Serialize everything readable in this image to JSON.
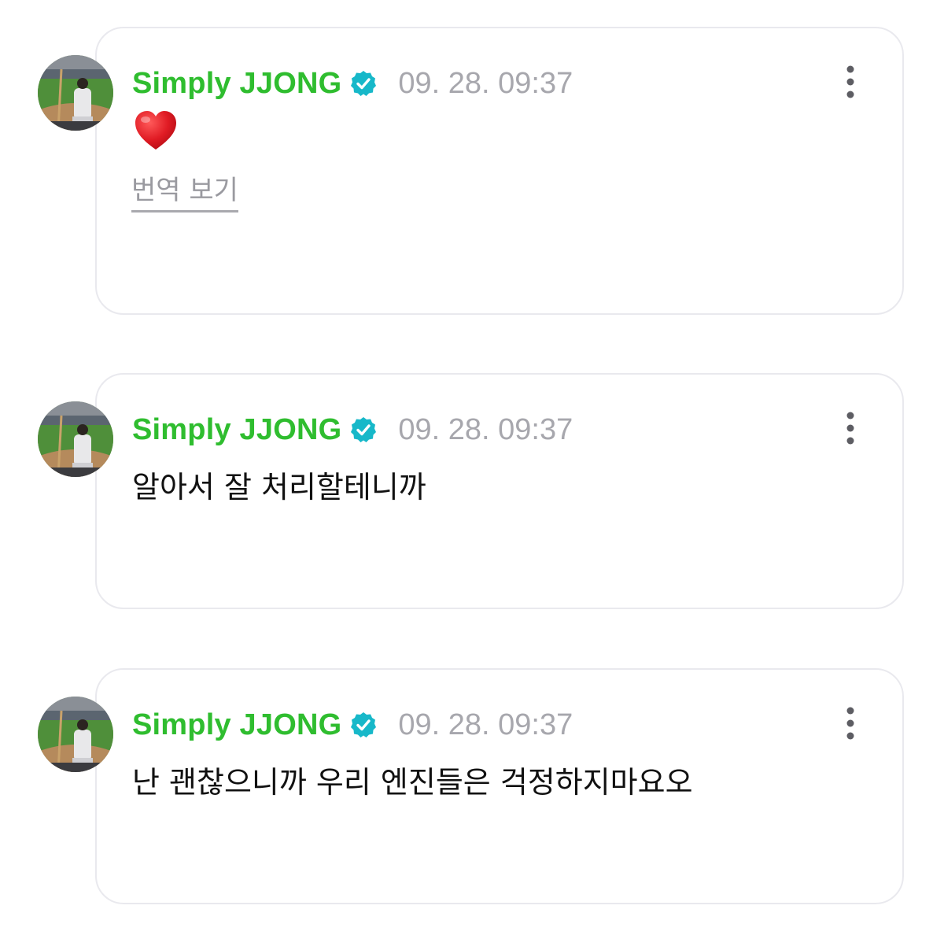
{
  "posts": [
    {
      "author": "Simply JJONG",
      "verified_icon": "verified-badge-icon",
      "timestamp": "09. 28. 09:37",
      "message": "",
      "emoji": "heart-icon",
      "translate_label": "번역 보기"
    },
    {
      "author": "Simply JJONG",
      "verified_icon": "verified-badge-icon",
      "timestamp": "09. 28. 09:37",
      "message": "알아서 잘 처리할테니까"
    },
    {
      "author": "Simply JJONG",
      "verified_icon": "verified-badge-icon",
      "timestamp": "09. 28. 09:37",
      "message": "난 괜찮으니까 우리 엔진들은 걱정하지마요오"
    }
  ],
  "colors": {
    "author": "#2fbd2f",
    "verified": "#17b8c9",
    "timestamp": "#a7a7ad",
    "text": "#111111",
    "card_border": "#e9e9ee"
  }
}
